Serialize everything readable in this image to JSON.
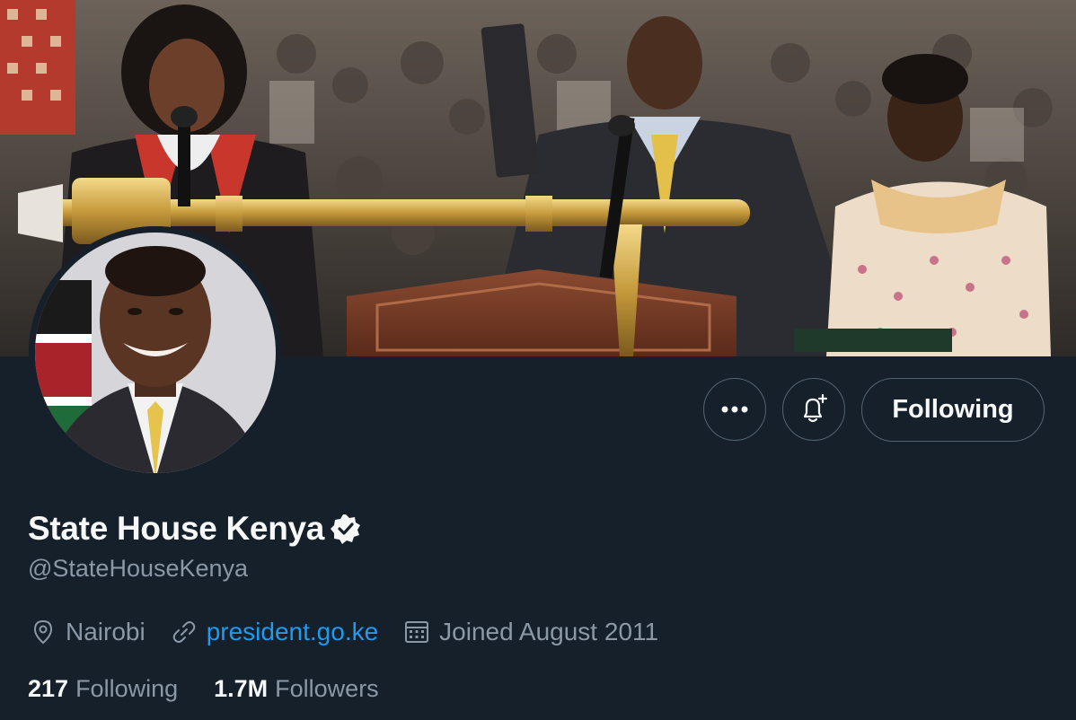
{
  "banner": {
    "image_description_icon": "inauguration-banner-photo"
  },
  "profile": {
    "display_name": "State House Kenya",
    "handle": "@StateHouseKenya",
    "verified": true,
    "location": "Nairobi",
    "website": "president.go.ke",
    "joined": "Joined August 2011"
  },
  "actions": {
    "more_icon": "more-icon",
    "notify_icon": "bell-plus-icon",
    "follow_label": "Following"
  },
  "stats": {
    "following_count": "217",
    "following_label": "Following",
    "followers_count": "1.7M",
    "followers_label": "Followers"
  },
  "colors": {
    "background": "#15202b",
    "text_primary": "#f7f9f9",
    "text_secondary": "#8b98a5",
    "link": "#1d9bf0",
    "border": "#536471"
  }
}
